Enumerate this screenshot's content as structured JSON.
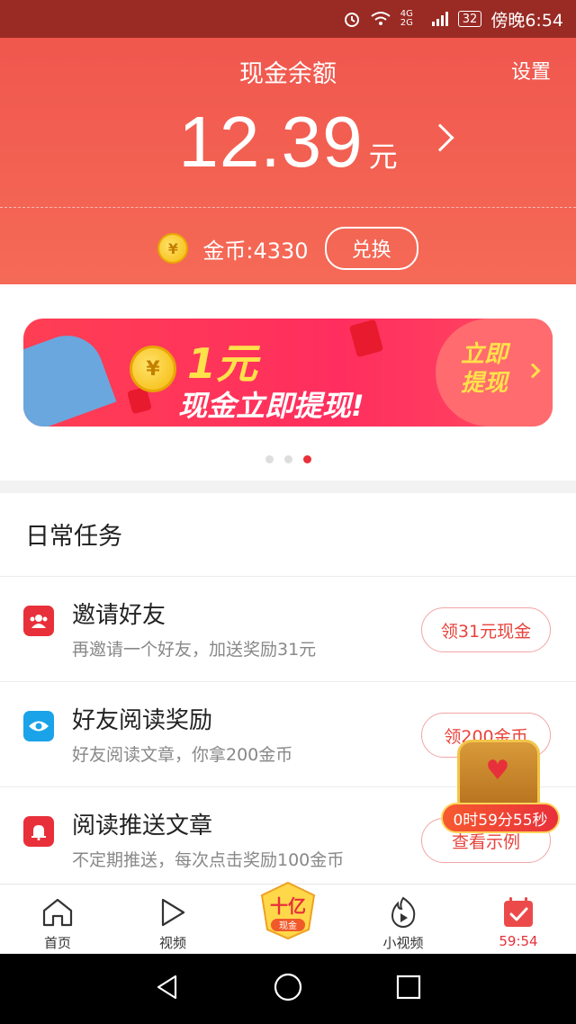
{
  "status_bar": {
    "network": "4G 2G",
    "battery": "32",
    "time": "傍晚6:54"
  },
  "header": {
    "title": "现金余额",
    "settings_label": "设置",
    "balance_value": "12.39",
    "balance_unit": "元",
    "coin_label": "金币:4330",
    "exchange_label": "兑换"
  },
  "banner": {
    "amount": "1元",
    "subtitle": "现金立即提现!",
    "cta_line1": "立即",
    "cta_line2": "提现",
    "dots_count": 3,
    "active_dot": 2
  },
  "tasks": {
    "title": "日常任务",
    "items": [
      {
        "name": "邀请好友",
        "desc": "再邀请一个好友，加送奖励31元",
        "button": "领31元现金",
        "icon": "invite-friends-icon",
        "color": "#e8303a"
      },
      {
        "name": "好友阅读奖励",
        "desc": "好友阅读文章，你拿200金币",
        "button": "领200金币",
        "icon": "eye-icon",
        "color": "#1aa3e8"
      },
      {
        "name": "阅读推送文章",
        "desc": "不定期推送，每次点击奖励100金币",
        "button": "查看示例",
        "icon": "bell-icon",
        "color": "#e8303a"
      }
    ]
  },
  "floating": {
    "timer_text": "0时59分55秒"
  },
  "bottom_nav": {
    "items": [
      {
        "label": "首页",
        "icon": "home-icon"
      },
      {
        "label": "视频",
        "icon": "play-icon"
      },
      {
        "label": "",
        "icon": "billion-cash-badge-icon",
        "badge_line1": "十亿",
        "badge_line2": "现金"
      },
      {
        "label": "小视频",
        "icon": "short-video-icon"
      },
      {
        "label": "59:54",
        "icon": "calendar-check-icon"
      }
    ]
  },
  "colors": {
    "header_red": "#f0574e",
    "accent_red": "#e8303a",
    "coin_gold": "#f5b90a",
    "banner_yellow": "#ffe14a"
  }
}
